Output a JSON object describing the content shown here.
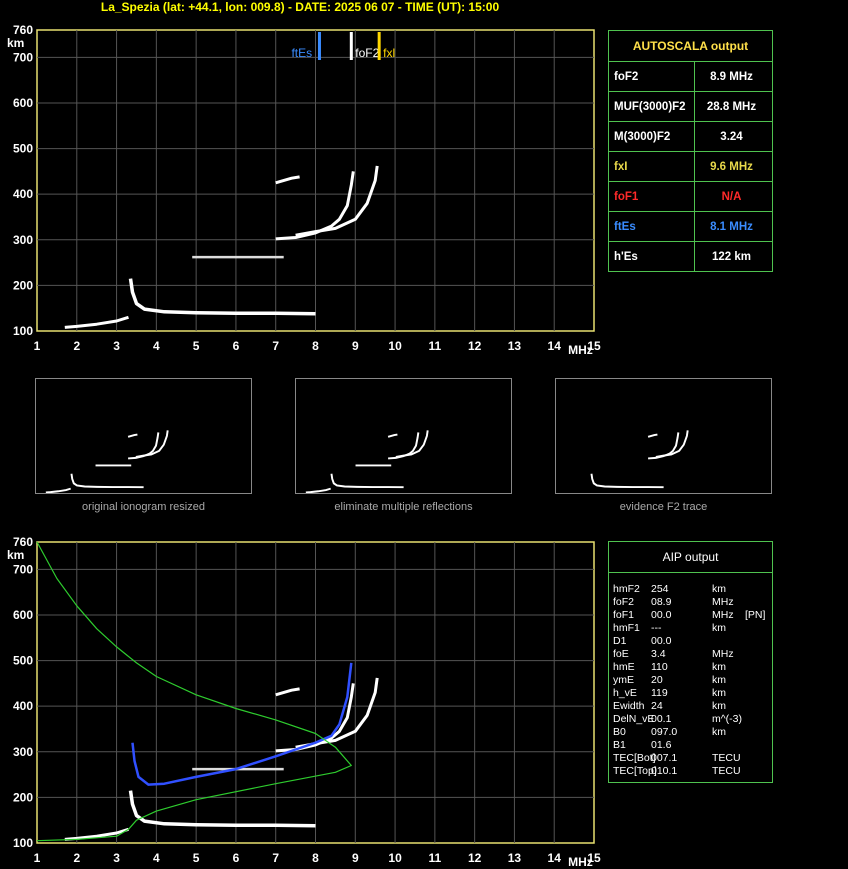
{
  "title": "La_Spezia (lat: +44.1, lon: 009.8) - DATE: 2025 06 07 - TIME (UT): 15:00",
  "chart_data": [
    {
      "type": "scatter",
      "name": "ionogram-top",
      "x_ticks": [
        "1",
        "2",
        "3",
        "4",
        "5",
        "6",
        "7",
        "8",
        "9",
        "10",
        "11",
        "12",
        "13",
        "14",
        "15"
      ],
      "y_ticks": [
        "100",
        "200",
        "300",
        "400",
        "500",
        "600",
        "700",
        "760"
      ],
      "xlabel": "MHz",
      "ylabel": "km",
      "xlim": [
        1,
        15
      ],
      "ylim": [
        100,
        760
      ],
      "markers": [
        {
          "label": "ftEs",
          "x": 8.1,
          "color": "#3a8cff"
        },
        {
          "label": "foF2",
          "x": 8.9,
          "color": "#ffffff"
        },
        {
          "label": "fxl",
          "x": 9.6,
          "color": "#ffd700"
        }
      ],
      "traces": {
        "E_layer": [
          [
            3.35,
            215
          ],
          [
            3.4,
            185
          ],
          [
            3.5,
            160
          ],
          [
            3.7,
            148
          ],
          [
            4.2,
            142
          ],
          [
            5,
            140
          ],
          [
            6,
            139
          ],
          [
            7,
            139
          ],
          [
            8,
            138
          ]
        ],
        "low": [
          [
            1.7,
            108
          ],
          [
            2,
            110
          ],
          [
            2.5,
            115
          ],
          [
            3,
            122
          ],
          [
            3.3,
            130
          ]
        ],
        "Es_patch": [
          [
            4.9,
            262
          ],
          [
            6,
            262
          ],
          [
            7.2,
            262
          ]
        ],
        "F2_o": [
          [
            7,
            302
          ],
          [
            7.5,
            305
          ],
          [
            8,
            315
          ],
          [
            8.4,
            330
          ],
          [
            8.6,
            345
          ],
          [
            8.8,
            375
          ],
          [
            8.9,
            420
          ],
          [
            8.95,
            450
          ]
        ],
        "F2_x": [
          [
            7.5,
            310
          ],
          [
            8,
            318
          ],
          [
            8.5,
            325
          ],
          [
            9,
            345
          ],
          [
            9.3,
            380
          ],
          [
            9.5,
            430
          ],
          [
            9.55,
            462
          ]
        ],
        "fragment": [
          [
            7,
            425
          ],
          [
            7.4,
            435
          ],
          [
            7.6,
            438
          ]
        ]
      }
    },
    {
      "type": "line",
      "name": "ionogram-bottom",
      "x_ticks": [
        "1",
        "2",
        "3",
        "4",
        "5",
        "6",
        "7",
        "8",
        "9",
        "10",
        "11",
        "12",
        "13",
        "14",
        "15"
      ],
      "y_ticks": [
        "100",
        "200",
        "300",
        "400",
        "500",
        "600",
        "700",
        "760"
      ],
      "xlabel": "MHz",
      "ylabel": "km",
      "xlim": [
        1,
        15
      ],
      "ylim": [
        100,
        760
      ],
      "traces": {
        "E_layer": [
          [
            3.35,
            215
          ],
          [
            3.4,
            185
          ],
          [
            3.5,
            160
          ],
          [
            3.7,
            148
          ],
          [
            4.2,
            142
          ],
          [
            5,
            140
          ],
          [
            6,
            139
          ],
          [
            7,
            139
          ],
          [
            8,
            138
          ]
        ],
        "low": [
          [
            1.7,
            108
          ],
          [
            2,
            110
          ],
          [
            2.5,
            115
          ],
          [
            3,
            122
          ],
          [
            3.3,
            130
          ]
        ],
        "Es_patch": [
          [
            4.9,
            262
          ],
          [
            6,
            262
          ],
          [
            7.2,
            262
          ]
        ],
        "F2_o": [
          [
            7,
            302
          ],
          [
            7.5,
            305
          ],
          [
            8,
            315
          ],
          [
            8.4,
            330
          ],
          [
            8.6,
            345
          ],
          [
            8.8,
            375
          ],
          [
            8.9,
            420
          ],
          [
            8.95,
            450
          ]
        ],
        "F2_x": [
          [
            7.5,
            310
          ],
          [
            8,
            318
          ],
          [
            8.5,
            325
          ],
          [
            9,
            345
          ],
          [
            9.3,
            380
          ],
          [
            9.5,
            430
          ],
          [
            9.55,
            462
          ]
        ],
        "fragment": [
          [
            7,
            425
          ],
          [
            7.4,
            435
          ],
          [
            7.6,
            438
          ]
        ],
        "virtual_height_fit": [
          [
            3.4,
            320
          ],
          [
            3.45,
            280
          ],
          [
            3.55,
            245
          ],
          [
            3.8,
            228
          ],
          [
            4.2,
            230
          ],
          [
            5,
            245
          ],
          [
            6,
            262
          ],
          [
            7,
            290
          ],
          [
            7.5,
            305
          ],
          [
            8,
            320
          ],
          [
            8.4,
            335
          ],
          [
            8.6,
            360
          ],
          [
            8.8,
            420
          ],
          [
            8.9,
            495
          ]
        ],
        "profile": [
          [
            1,
            760
          ],
          [
            1.5,
            680
          ],
          [
            2,
            620
          ],
          [
            2.5,
            570
          ],
          [
            3,
            530
          ],
          [
            3.5,
            495
          ],
          [
            4,
            465
          ],
          [
            5,
            425
          ],
          [
            6,
            395
          ],
          [
            7,
            370
          ],
          [
            8,
            340
          ],
          [
            8.5,
            310
          ],
          [
            8.9,
            270
          ],
          [
            8.5,
            255
          ],
          [
            7,
            230
          ],
          [
            5,
            195
          ],
          [
            4,
            170
          ],
          [
            3.5,
            150
          ],
          [
            3.3,
            130
          ],
          [
            3,
            115
          ],
          [
            2,
            108
          ],
          [
            1,
            105
          ]
        ]
      }
    }
  ],
  "thumbnails": {
    "original": "original ionogram resized",
    "multiple": "eliminate multiple reflections",
    "evidence": "evidence F2 trace"
  },
  "autoscala": {
    "header": "AUTOSCALA output",
    "rows": [
      {
        "label": "foF2",
        "value": "8.9 MHz",
        "color": "#ffffff"
      },
      {
        "label": "MUF(3000)F2",
        "value": "28.8 MHz",
        "color": "#ffffff"
      },
      {
        "label": "M(3000)F2",
        "value": "3.24",
        "color": "#ffffff"
      },
      {
        "label": "fxI",
        "value": "9.6 MHz",
        "color": "#e8d84a"
      },
      {
        "label": "foF1",
        "value": "N/A",
        "color": "#ff2a2a"
      },
      {
        "label": "ftEs",
        "value": "8.1 MHz",
        "color": "#3a8cff"
      },
      {
        "label": "h'Es",
        "value": "122     km",
        "color": "#ffffff"
      }
    ]
  },
  "aip": {
    "header": "AIP output",
    "rows": [
      {
        "p": "hmF2",
        "v": "254",
        "u": "km",
        "e": ""
      },
      {
        "p": "foF2",
        "v": "08.9",
        "u": "MHz",
        "e": ""
      },
      {
        "p": "foF1",
        "v": "00.0",
        "u": "MHz",
        "e": "[PN]"
      },
      {
        "p": "hmF1",
        "v": "---",
        "u": "km",
        "e": ""
      },
      {
        "p": "D1",
        "v": "00.0",
        "u": "",
        "e": ""
      },
      {
        "p": "foE",
        "v": "3.4",
        "u": "MHz",
        "e": ""
      },
      {
        "p": "hmE",
        "v": "110",
        "u": "km",
        "e": ""
      },
      {
        "p": "ymE",
        "v": "20",
        "u": "km",
        "e": ""
      },
      {
        "p": "h_vE",
        "v": "119",
        "u": "km",
        "e": ""
      },
      {
        "p": "Ewidth",
        "v": "24",
        "u": "km",
        "e": ""
      },
      {
        "p": "DelN_vE",
        "v": "00.1",
        "u": "m^(-3)",
        "e": ""
      },
      {
        "p": "B0",
        "v": "097.0",
        "u": "km",
        "e": ""
      },
      {
        "p": "B1",
        "v": "01.6",
        "u": "",
        "e": ""
      },
      {
        "p": "TEC[Bot]",
        "v": "007.1",
        "u": "TECU",
        "e": ""
      },
      {
        "p": "TEC[Top]",
        "v": "010.1",
        "u": "TECU",
        "e": ""
      }
    ]
  }
}
